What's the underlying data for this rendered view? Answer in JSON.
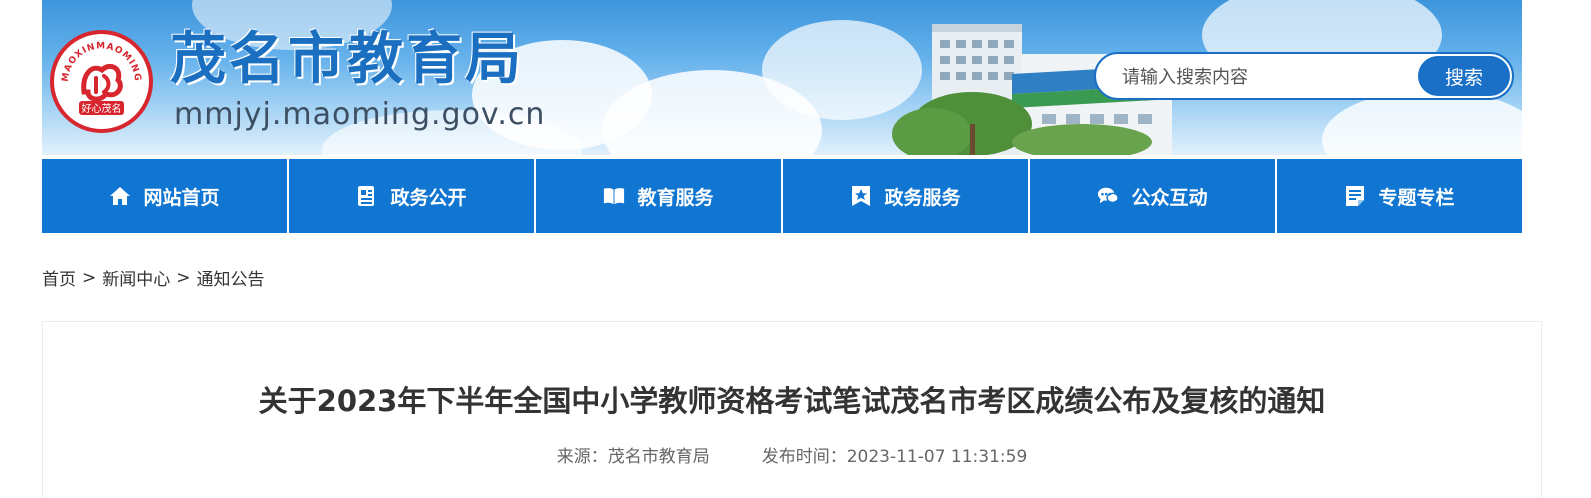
{
  "header": {
    "site_title": "茂名市教育局",
    "site_domain": "mmjyj.maoming.gov.cn",
    "logo_text_top": "MAOXINMAOMING",
    "logo_text_bottom": "好心茂名"
  },
  "search": {
    "placeholder": "请输入搜索内容",
    "button_label": "搜索"
  },
  "nav": {
    "items": [
      {
        "label": "网站首页",
        "icon": "home-icon"
      },
      {
        "label": "政务公开",
        "icon": "document-icon"
      },
      {
        "label": "教育服务",
        "icon": "book-icon"
      },
      {
        "label": "政务服务",
        "icon": "star-badge-icon"
      },
      {
        "label": "公众互动",
        "icon": "chat-icon"
      },
      {
        "label": "专题专栏",
        "icon": "notepad-icon"
      }
    ]
  },
  "breadcrumb": {
    "items": [
      "首页",
      "新闻中心",
      "通知公告"
    ],
    "separator": ">"
  },
  "article": {
    "title": "关于2023年下半年全国中小学教师资格考试笔试茂名市考区成绩公布及复核的通知",
    "source_label": "来源：",
    "source": "茂名市教育局",
    "publish_label": "发布时间：",
    "publish_time": "2023-11-07 11:31:59"
  },
  "colors": {
    "nav_bg": "#1076d1",
    "title_blue": "#1b6fc1",
    "search_button": "#1a70c7",
    "logo_red": "#d7262e"
  }
}
